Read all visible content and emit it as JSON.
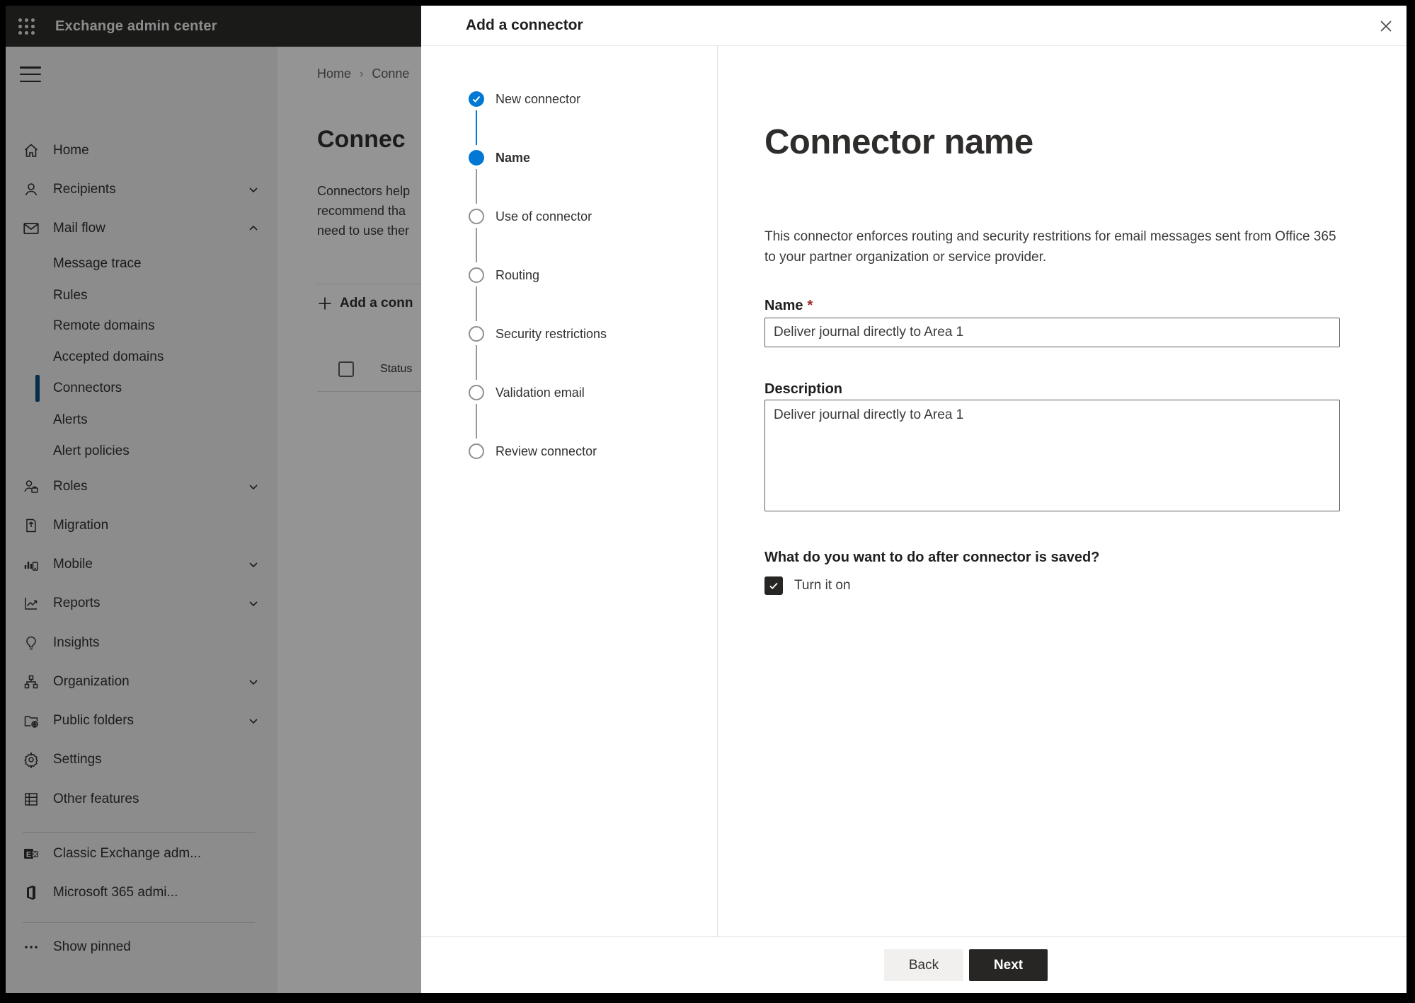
{
  "app_header": {
    "title": "Exchange admin center"
  },
  "sidebar": {
    "items": [
      "Home",
      "Recipients",
      "Mail flow",
      "Message trace",
      "Rules",
      "Remote domains",
      "Accepted domains",
      "Connectors",
      "Alerts",
      "Alert policies",
      "Roles",
      "Migration",
      "Mobile",
      "Reports",
      "Insights",
      "Organization",
      "Public folders",
      "Settings",
      "Other features",
      "Classic Exchange adm...",
      "Microsoft 365 admi...",
      "Show pinned"
    ],
    "selected_item": "Connectors"
  },
  "page": {
    "breadcrumb": {
      "home": "Home",
      "separator": "›",
      "current": "Conne"
    },
    "title": "Connec",
    "intro_lines": [
      "Connectors help",
      "recommend tha",
      "need to use ther"
    ],
    "add_connector_button": "Add a conn",
    "list_header": {
      "status_column": "Status"
    }
  },
  "dialog": {
    "title": "Add a connector",
    "steps": [
      {
        "label": "New connector",
        "state": "completed"
      },
      {
        "label": "Name",
        "state": "active"
      },
      {
        "label": "Use of connector",
        "state": "pending"
      },
      {
        "label": "Routing",
        "state": "pending"
      },
      {
        "label": "Security restrictions",
        "state": "pending"
      },
      {
        "label": "Validation email",
        "state": "pending"
      },
      {
        "label": "Review connector",
        "state": "pending"
      }
    ],
    "content": {
      "heading": "Connector name",
      "intro_lines": [
        "This connector enforces routing and security restritions for email messages sent from Office 365",
        "to your partner organization or service provider."
      ],
      "name_label": "Name",
      "required_marker": "*",
      "name_value": "Deliver journal directly to Area 1",
      "description_label": "Description",
      "description_value": "Deliver journal directly to Area 1",
      "after_save_question": "What do you want to do after connector is saved?",
      "turn_on": {
        "label": "Turn it on",
        "checked": true
      }
    },
    "footer": {
      "back": "Back",
      "next": "Next"
    }
  },
  "colors": {
    "accent_blue": "#0078d4",
    "required_red": "#a4262c",
    "dark_button": "#272625",
    "header_bg": "#2e2d2c",
    "sidebar_bg": "#f3f2f1"
  }
}
